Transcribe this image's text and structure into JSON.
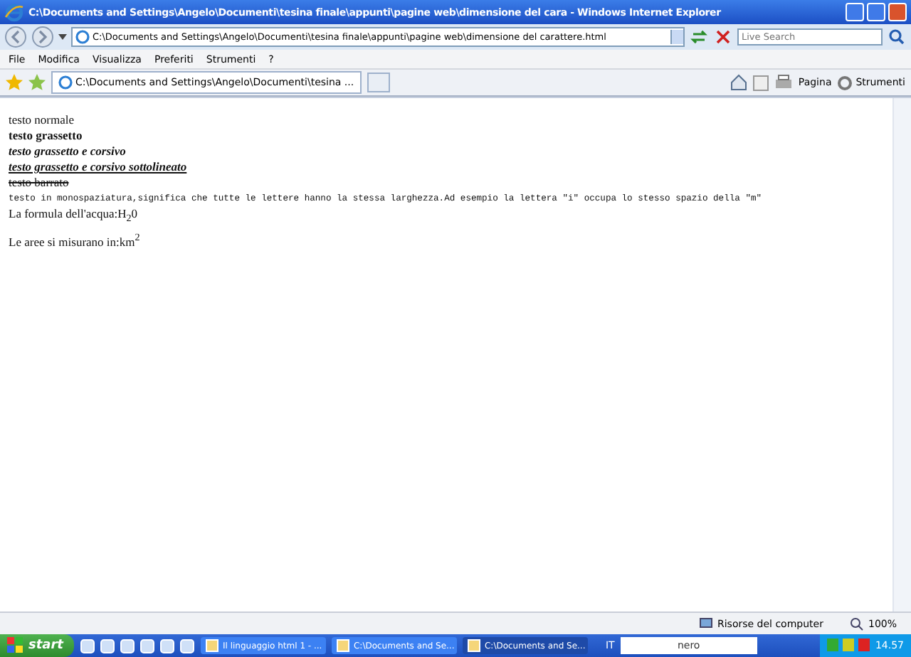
{
  "window": {
    "title": "C:\\Documents and Settings\\Angelo\\Documenti\\tesina finale\\appunti\\pagine web\\dimensione del cara - Windows Internet Explorer"
  },
  "address": {
    "value": "C:\\Documents and Settings\\Angelo\\Documenti\\tesina finale\\appunti\\pagine web\\dimensione del carattere.html"
  },
  "search": {
    "placeholder": "Live Search"
  },
  "menu": [
    "File",
    "Modifica",
    "Visualizza",
    "Preferiti",
    "Strumenti",
    "?"
  ],
  "tabs": [
    {
      "label": "C:\\Documents and Settings\\Angelo\\Documenti\\tesina ...",
      "selected": true
    }
  ],
  "toolbar": {
    "page": "Pagina",
    "tools": "Strumenti"
  },
  "content": [
    {
      "kind": "normal",
      "text": "testo normale"
    },
    {
      "kind": "bold",
      "text": "testo grassetto"
    },
    {
      "kind": "bold-italic",
      "text": "testo grassetto e corsivo"
    },
    {
      "kind": "bold-italic-underline",
      "text": "testo grassetto e corsivo sottolineato"
    },
    {
      "kind": "strike",
      "text": "testo barrato"
    },
    {
      "kind": "mono",
      "text": "testo in monospaziatura,significa che tutte le lettere hanno la stessa larghezza.Ad esempio la lettera \"i\" occupa lo stesso spazio della \"m\""
    },
    {
      "kind": "rich",
      "text": "La formula dell'acqua:H$_{2}$0"
    },
    {
      "kind": "rich",
      "text": "Le aree si misurano in:km$^{2}$"
    }
  ],
  "status_bar": {
    "zone": "Risorse del computer",
    "zoom": "100%"
  },
  "taskbar": {
    "start": "start",
    "tasks": [
      {
        "label": "Il linguaggio html 1 - ...",
        "selected": false
      },
      {
        "label": "C:\\Documents and Se...",
        "selected": false
      },
      {
        "label": "C:\\Documents and Se...",
        "selected": true
      }
    ],
    "language": "IT",
    "toolbar_logo": "nero",
    "clock": "14.57"
  }
}
